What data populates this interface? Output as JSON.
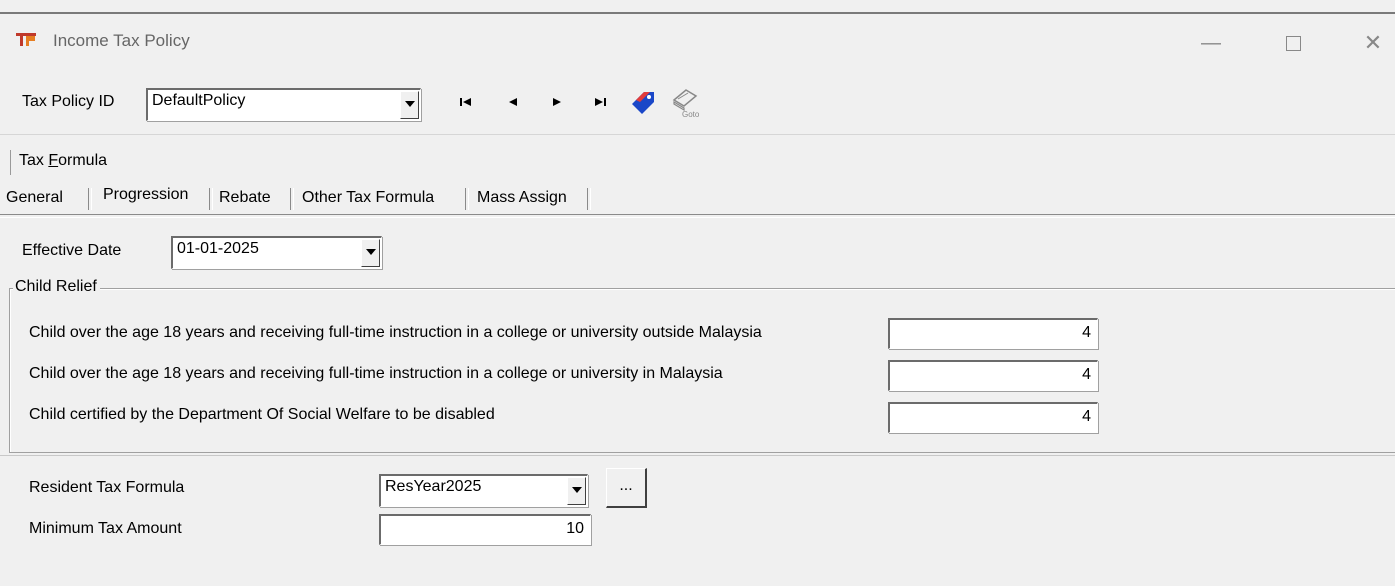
{
  "window": {
    "title": "Income Tax Policy",
    "icon": "app-logo-icon",
    "controls": {
      "minimize": "—",
      "close": "✕"
    }
  },
  "toolbar": {
    "policy_id_label": "Tax Policy ID",
    "policy_id_value": "DefaultPolicy",
    "nav_icons": [
      "first-record-icon",
      "previous-record-icon",
      "next-record-icon",
      "last-record-icon",
      "edit-tag-icon",
      "goto-icon"
    ],
    "goto_caption": "Goto"
  },
  "section": {
    "tax_formula_label_pre": "Tax ",
    "tax_formula_label_acc": "F",
    "tax_formula_label_post": "ormula"
  },
  "tabs": [
    {
      "label": "General"
    },
    {
      "label": "Progression"
    },
    {
      "label": "Rebate"
    },
    {
      "label": "Other Tax Formula"
    },
    {
      "label": "Mass Assign"
    }
  ],
  "progression": {
    "effective_date_label": "Effective Date",
    "effective_date_value": "01-01-2025",
    "child_relief": {
      "title": "Child Relief",
      "rows": [
        {
          "label": "Child over the age 18 years and receiving full-time instruction in a college or university outside Malaysia",
          "value": "4"
        },
        {
          "label": "Child over the age 18 years and receiving full-time instruction in a college or university in Malaysia",
          "value": "4"
        },
        {
          "label": "Child certified by the Department Of Social Welfare to be disabled",
          "value": "4"
        }
      ]
    },
    "resident_tax_formula_label": "Resident Tax Formula",
    "resident_tax_formula_value": "ResYear2025",
    "browse_button": "...",
    "minimum_tax_label": "Minimum Tax Amount",
    "minimum_tax_value": "10"
  },
  "colors": {
    "background": "#f0f0f0",
    "accent_icon": "#1a47c8",
    "logo": "#c0392b"
  }
}
